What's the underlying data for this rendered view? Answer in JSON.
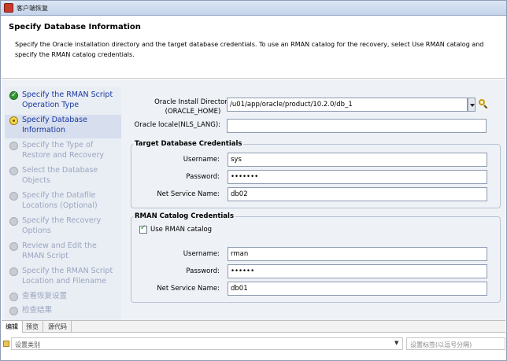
{
  "window": {
    "title": "客户端恢复"
  },
  "header": {
    "title": "Specify Database Information",
    "description": "Specify the Oracle installation directory and the target database credentials.  To use an RMAN catalog for the recovery, select Use RMAN catalog and specify the RMAN catalog credentials."
  },
  "sidebar": {
    "steps": [
      {
        "label": "Specify the RMAN Script Operation Type",
        "state": "done"
      },
      {
        "label": "Specify Database Information",
        "state": "current"
      },
      {
        "label": "Specify the Type of Restore and Recovery",
        "state": "pending"
      },
      {
        "label": "Select the Database Objects",
        "state": "pending"
      },
      {
        "label": "Specify the Datafile Locations (Optional)",
        "state": "pending"
      },
      {
        "label": "Specify the Recovery Options",
        "state": "pending"
      },
      {
        "label": "Review and Edit the RMAN Script",
        "state": "pending"
      },
      {
        "label": "Specify the RMAN Script Location and Filename",
        "state": "pending"
      },
      {
        "label": "查看恢复设置",
        "state": "pending"
      },
      {
        "label": "检查结果",
        "state": "pending"
      }
    ]
  },
  "form": {
    "oracle_home_label_1": "Oracle Install Directory",
    "oracle_home_label_2": "(ORACLE_HOME)",
    "oracle_home_value": "/u01/app/oracle/product/10.2.0/db_1",
    "nls_lang_label": "Oracle locale(NLS_LANG):",
    "nls_lang_value": "",
    "target_group": {
      "title": "Target Database Credentials",
      "username_label": "Username:",
      "username_value": "sys",
      "password_label": "Password:",
      "password_value": "•••••••",
      "service_label": "Net Service Name:",
      "service_value": "db02"
    },
    "catalog_group": {
      "title": "RMAN Catalog Credentials",
      "use_catalog_label": "Use RMAN catalog",
      "use_catalog_checked": true,
      "username_label": "Username:",
      "username_value": "rman",
      "password_label": "Password:",
      "password_value": "••••••",
      "service_label": "Net Service Name:",
      "service_value": "db01"
    }
  },
  "bottom_tabs": [
    "编辑",
    "预览",
    "源代码"
  ],
  "status": {
    "category_placeholder": "设置类别",
    "tags_placeholder": "设置标签(以逗号分隔)"
  }
}
